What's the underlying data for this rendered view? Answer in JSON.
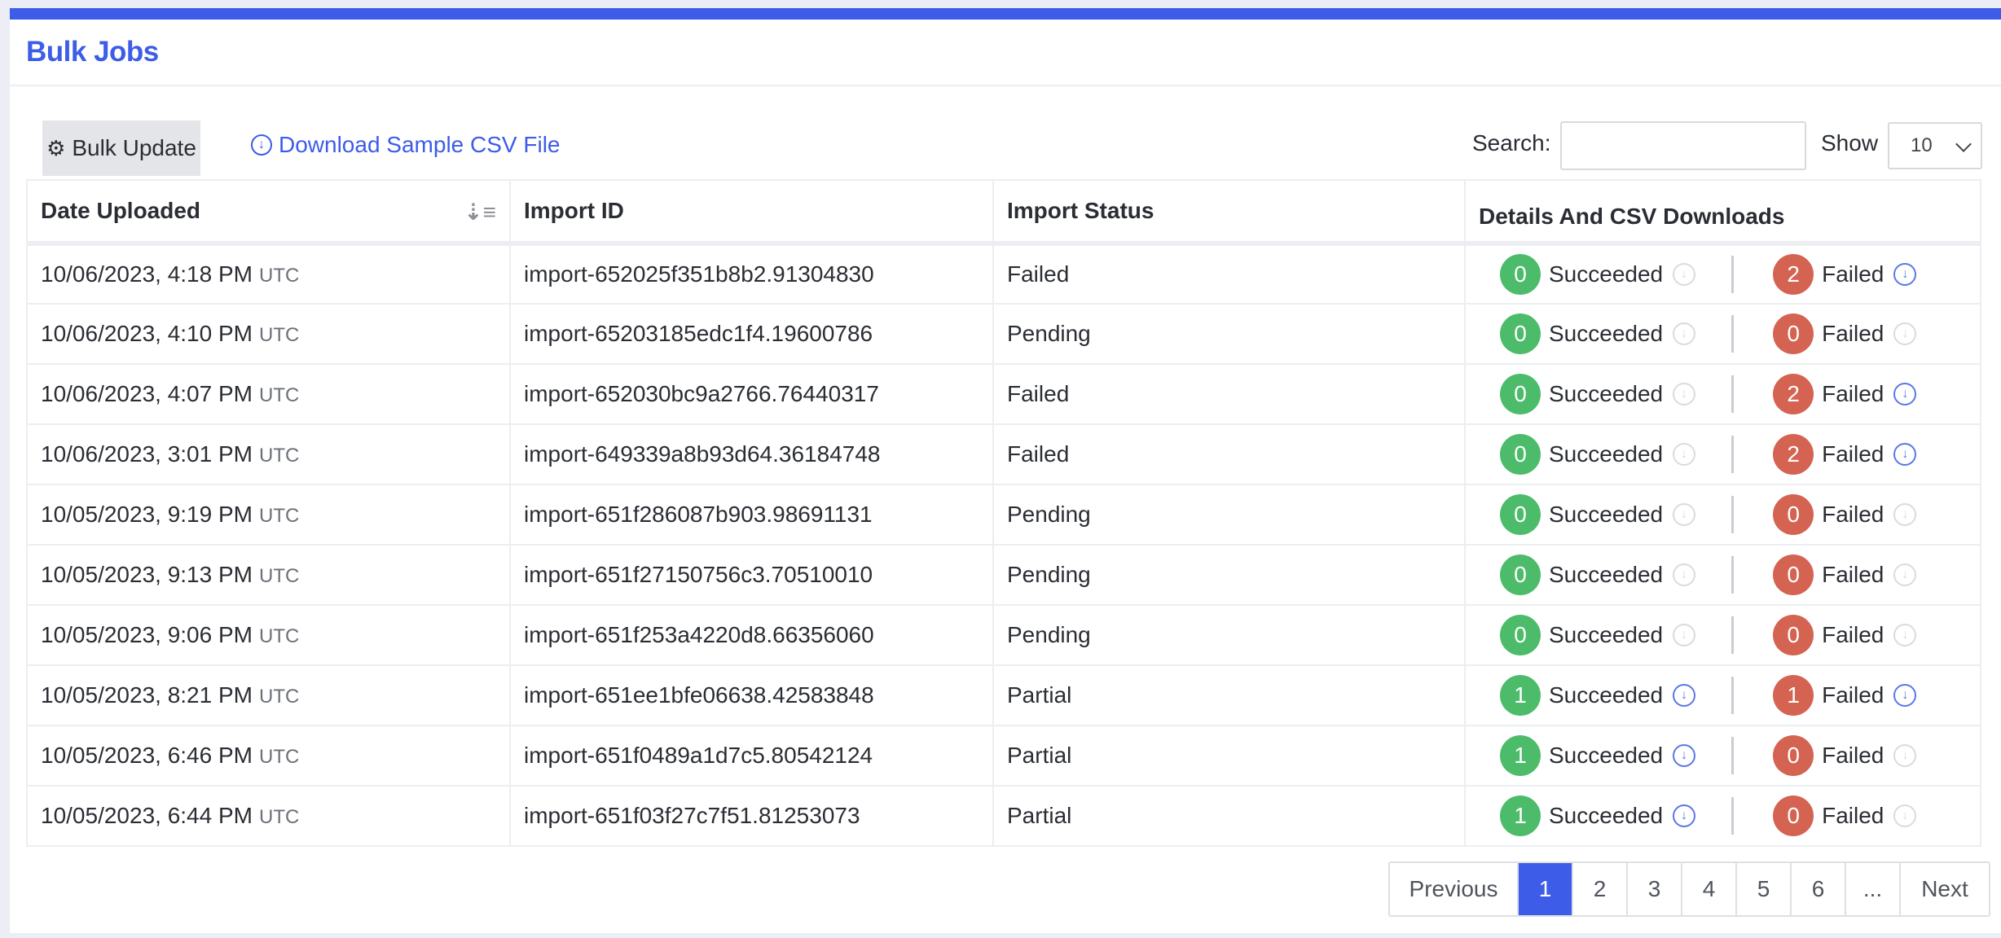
{
  "header": {
    "title": "Bulk Jobs"
  },
  "toolbar": {
    "bulk_update_label": "Bulk Update",
    "download_label": "Download Sample CSV File",
    "search_label": "Search:",
    "search_value": "",
    "show_label": "Show",
    "show_value": "10"
  },
  "table": {
    "columns": [
      "Date Uploaded",
      "Import ID",
      "Import Status",
      "Details And CSV Downloads"
    ],
    "succeeded_label": "Succeeded",
    "failed_label": "Failed",
    "rows": [
      {
        "date": "10/06/2023, 4:18 PM",
        "tz": "UTC",
        "id": "import-652025f351b8b2.91304830",
        "status": "Failed",
        "succeeded": "0",
        "failed": "2"
      },
      {
        "date": "10/06/2023, 4:10 PM",
        "tz": "UTC",
        "id": "import-65203185edc1f4.19600786",
        "status": "Pending",
        "succeeded": "0",
        "failed": "0"
      },
      {
        "date": "10/06/2023, 4:07 PM",
        "tz": "UTC",
        "id": "import-652030bc9a2766.76440317",
        "status": "Failed",
        "succeeded": "0",
        "failed": "2"
      },
      {
        "date": "10/06/2023, 3:01 PM",
        "tz": "UTC",
        "id": "import-649339a8b93d64.36184748",
        "status": "Failed",
        "succeeded": "0",
        "failed": "2"
      },
      {
        "date": "10/05/2023, 9:19 PM",
        "tz": "UTC",
        "id": "import-651f286087b903.98691131",
        "status": "Pending",
        "succeeded": "0",
        "failed": "0"
      },
      {
        "date": "10/05/2023, 9:13 PM",
        "tz": "UTC",
        "id": "import-651f27150756c3.70510010",
        "status": "Pending",
        "succeeded": "0",
        "failed": "0"
      },
      {
        "date": "10/05/2023, 9:06 PM",
        "tz": "UTC",
        "id": "import-651f253a4220d8.66356060",
        "status": "Pending",
        "succeeded": "0",
        "failed": "0"
      },
      {
        "date": "10/05/2023, 8:21 PM",
        "tz": "UTC",
        "id": "import-651ee1bfe06638.42583848",
        "status": "Partial",
        "succeeded": "1",
        "failed": "1"
      },
      {
        "date": "10/05/2023, 6:46 PM",
        "tz": "UTC",
        "id": "import-651f0489a1d7c5.80542124",
        "status": "Partial",
        "succeeded": "1",
        "failed": "0"
      },
      {
        "date": "10/05/2023, 6:44 PM",
        "tz": "UTC",
        "id": "import-651f03f27c7f51.81253073",
        "status": "Partial",
        "succeeded": "1",
        "failed": "0"
      }
    ]
  },
  "pagination": {
    "previous": "Previous",
    "pages": [
      "1",
      "2",
      "3",
      "4",
      "5",
      "6",
      "..."
    ],
    "active": "1",
    "next": "Next"
  },
  "icons": {
    "gear": "gear-icon",
    "download": "download-circle-icon",
    "sort": "sort-descending-icon",
    "chevron": "chevron-down-icon"
  },
  "colors": {
    "accent": "#3d5ce8",
    "success": "#4cbc6a",
    "danger": "#d46352",
    "download_active": "#5a78e6",
    "download_disabled": "#d9dbe0"
  }
}
